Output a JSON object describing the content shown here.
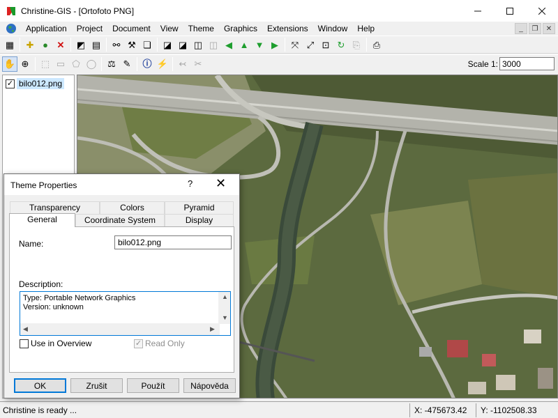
{
  "window": {
    "title": "Christine-GIS - [Ortofoto PNG]",
    "minimize_icon": "minimize-icon",
    "maximize_icon": "maximize-icon",
    "close_icon": "close-icon"
  },
  "menu": {
    "items": [
      "Application",
      "Project",
      "Document",
      "View",
      "Theme",
      "Graphics",
      "Extensions",
      "Window",
      "Help"
    ]
  },
  "toolbar1": {
    "icons": [
      "properties-icon",
      "add-theme-icon",
      "add-layer-icon",
      "delete-icon",
      "layer-properties-icon",
      "table-icon",
      "find-icon",
      "query-icon",
      "copy-icon",
      "layout-1-icon",
      "layout-2-icon",
      "layout-3-icon",
      "layout-4-icon",
      "move-left-icon",
      "move-up-icon",
      "move-down-icon",
      "move-right-icon",
      "zoom-extent-icon",
      "zoom-full-icon",
      "zoom-layer-icon",
      "refresh-icon",
      "export-icon",
      "print-icon"
    ]
  },
  "toolbar2": {
    "icons": [
      "pan-hand-icon",
      "zoom-in-icon",
      "select-feature-icon",
      "select-rect-icon",
      "select-poly-icon",
      "select-circle-icon",
      "measure-icon",
      "label-icon",
      "info-icon",
      "hotlink-icon",
      "draw-line-icon",
      "erase-icon"
    ],
    "scale_label": "Scale 1:",
    "scale_value": "3000"
  },
  "legend": {
    "items": [
      {
        "label": "bilo012.png",
        "checked": "✓"
      }
    ]
  },
  "status": {
    "message": "Christine is ready ...",
    "x": "X: -475673.42",
    "y": "Y: -1102508.33"
  },
  "dialog": {
    "title": "Theme Properties",
    "help": "?",
    "tabs_row1": [
      "Transparency",
      "Colors",
      "Pyramid"
    ],
    "tabs_row2": [
      "General",
      "Coordinate System",
      "Display"
    ],
    "name_label": "Name:",
    "name_value": "bilo012.png",
    "description_label": "Description:",
    "description_text": "Type: Portable Network Graphics\nVersion: unknown",
    "use_in_overview": {
      "label": "Use in Overview",
      "checked": ""
    },
    "read_only": {
      "label": "Read Only",
      "checked": "✓"
    },
    "buttons": {
      "ok": "OK",
      "cancel": "Zrušit",
      "apply": "Použít",
      "help": "Nápověda"
    }
  }
}
